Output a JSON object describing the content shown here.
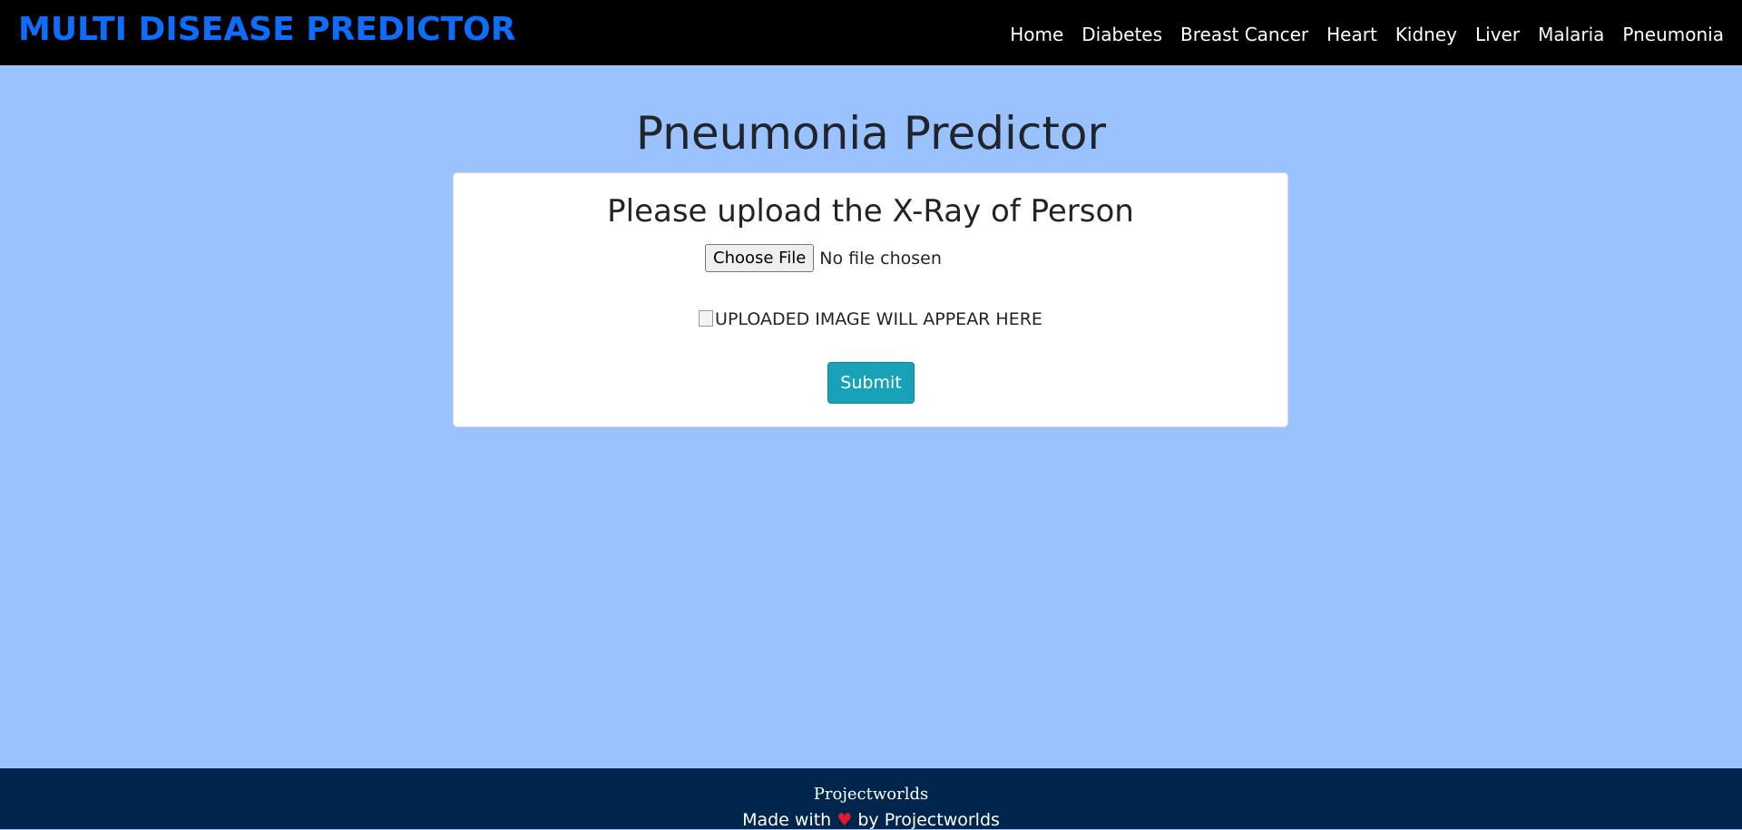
{
  "navbar": {
    "brand": "MULTI DISEASE PREDICTOR",
    "links": [
      "Home",
      "Diabetes",
      "Breast Cancer",
      "Heart",
      "Kidney",
      "Liver",
      "Malaria",
      "Pneumonia"
    ]
  },
  "page": {
    "title": "Pneumonia Predictor"
  },
  "form": {
    "heading": "Please upload the X-Ray of Person",
    "file_button_label": "Choose File",
    "file_status": "No file chosen",
    "image_alt": "UPLOADED IMAGE WILL APPEAR HERE",
    "submit_label": "Submit"
  },
  "footer": {
    "brand": "Projectworlds",
    "credit_prefix": "Made with",
    "heart_icon": "♥",
    "credit_suffix": "by Projectworlds"
  },
  "colors": {
    "background": "#9ac2fe",
    "navbar": "#000000",
    "brand": "#0d6efd",
    "submit": "#17a2b8",
    "footer": "#00264d",
    "heart": "#e0192a"
  }
}
